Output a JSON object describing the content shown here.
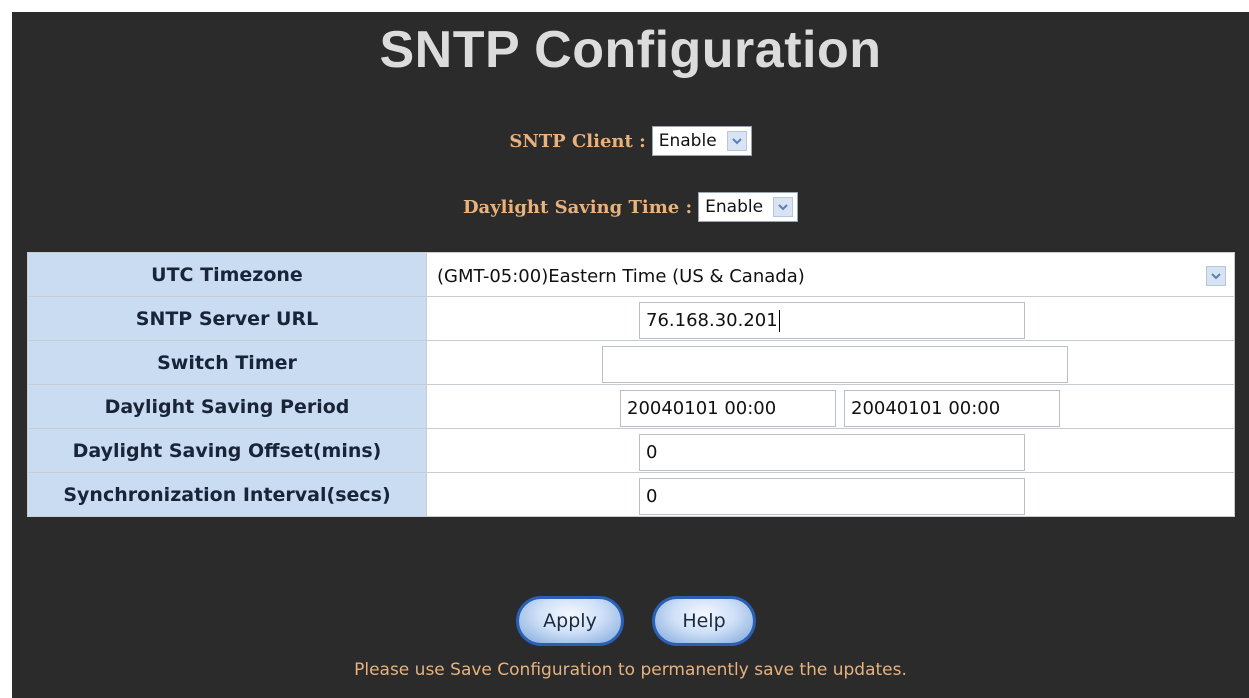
{
  "page": {
    "title": "SNTP Configuration"
  },
  "sntp_client": {
    "label": "SNTP Client :",
    "value": "Enable"
  },
  "daylight_saving_time": {
    "label": "Daylight Saving Time :",
    "value": "Enable"
  },
  "table": {
    "utc_timezone": {
      "label": "UTC Timezone",
      "value": "(GMT-05:00)Eastern Time (US & Canada)"
    },
    "sntp_server_url": {
      "label": "SNTP Server URL",
      "value": "76.168.30.201"
    },
    "switch_timer": {
      "label": "Switch Timer",
      "value": ""
    },
    "daylight_saving_period": {
      "label": "Daylight Saving Period",
      "start": "20040101 00:00",
      "end": "20040101 00:00"
    },
    "daylight_saving_offset": {
      "label": "Daylight Saving Offset(mins)",
      "value": "0"
    },
    "sync_interval": {
      "label": "Synchronization Interval(secs)",
      "value": "0"
    }
  },
  "buttons": {
    "apply": "Apply",
    "help": "Help"
  },
  "note": "Please use Save Configuration to permanently save the updates.",
  "colors": {
    "panel_bg": "#2b2b2b",
    "label_orange": "#e7b27e",
    "key_cell_bg": "#c9dcf1",
    "button_border": "#2a5fb5"
  },
  "icons": {
    "dropdown": "chevron-down-icon"
  }
}
